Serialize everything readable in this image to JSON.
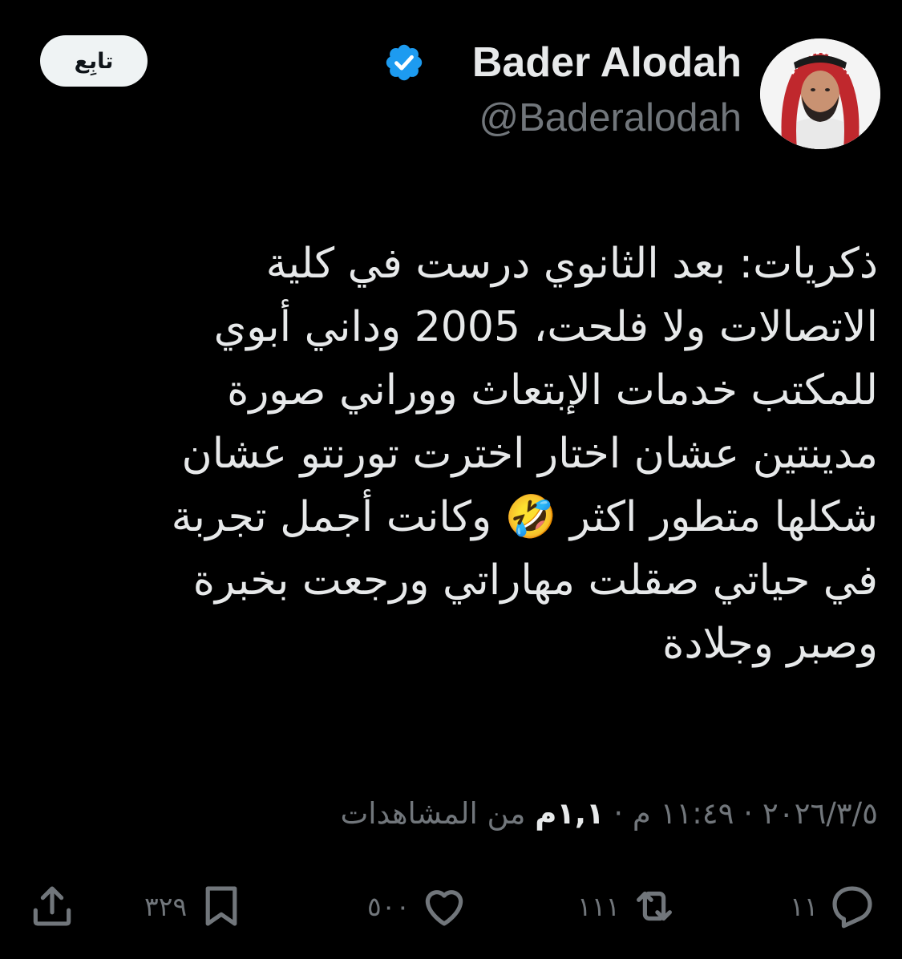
{
  "author": {
    "name": "Bader Alodah",
    "handle": "@Baderalodah",
    "verified": true
  },
  "follow_button": {
    "label": "تابِع"
  },
  "tweet": {
    "lines": [
      "ذكريات: بعد الثانوي درست في كلية",
      "الاتصالات ولا فلحت، 2005 وداني أبوي",
      "للمكتب خدمات الإبتعاث ووراني صورة",
      "مدينتين عشان اختار اخترت تورنتو عشان",
      "شكلها متطور اكثر 🤣     وكانت أجمل تجربة",
      "في حياتي صقلت مهاراتي ورجعت بخبرة",
      "وصبر وجلادة"
    ]
  },
  "meta": {
    "date": "٢٠٢٦/٣/٥",
    "separator": "·",
    "time": "١١:٤٩ م",
    "views_count": "١,١م",
    "views_label": "من المشاهدات"
  },
  "actions": {
    "replies": "١١",
    "reposts": "١١١",
    "likes": "٥٠٠",
    "bookmarks": "٣٢٩"
  },
  "colors": {
    "background": "#000000",
    "text": "#e7e9ea",
    "muted": "#71767b",
    "verified": "#1d9bf0",
    "follow_bg": "#eff3f4"
  }
}
